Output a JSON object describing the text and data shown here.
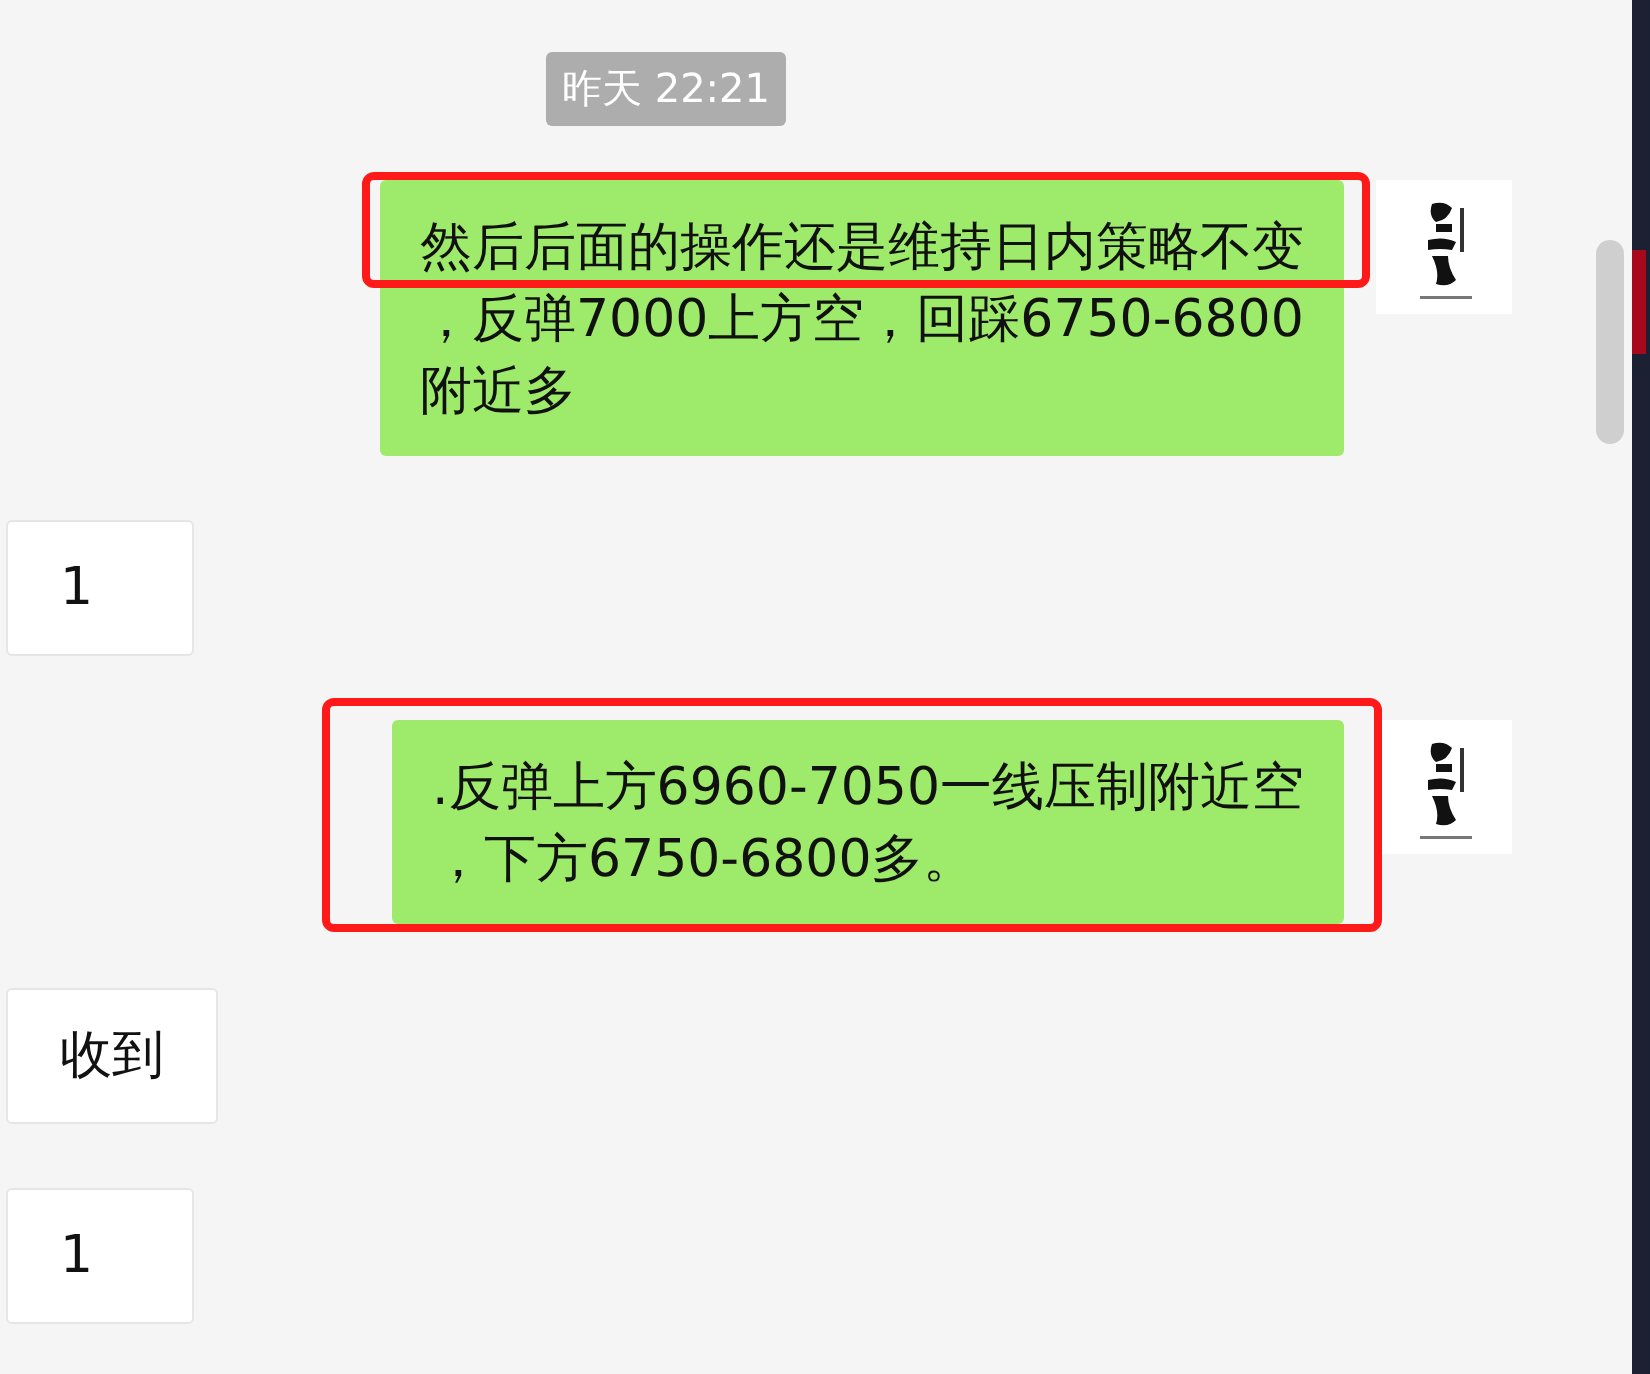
{
  "timestamp": "昨天 22:21",
  "messages": [
    {
      "kind": "outgoing",
      "lines": [
        {
          "text": "然后后面的操作还是维持日内策略不变",
          "highlighted": true
        },
        {
          "text": "，反弹7000上方空，回踩6750-6800",
          "highlighted": false
        },
        {
          "text": "附近多",
          "highlighted": false
        }
      ]
    },
    {
      "kind": "incoming",
      "lines": [
        {
          "text": "1",
          "highlighted": false
        }
      ]
    },
    {
      "kind": "outgoing",
      "lines": [
        {
          "text": ".反弹上方6960-7050一线压制附近空",
          "highlighted": true
        },
        {
          "text": "，下方6750-6800多。",
          "highlighted": true
        }
      ]
    },
    {
      "kind": "incoming",
      "lines": [
        {
          "text": "收到",
          "highlighted": false
        }
      ]
    },
    {
      "kind": "incoming",
      "lines": [
        {
          "text": "1",
          "highlighted": false
        }
      ]
    }
  ]
}
